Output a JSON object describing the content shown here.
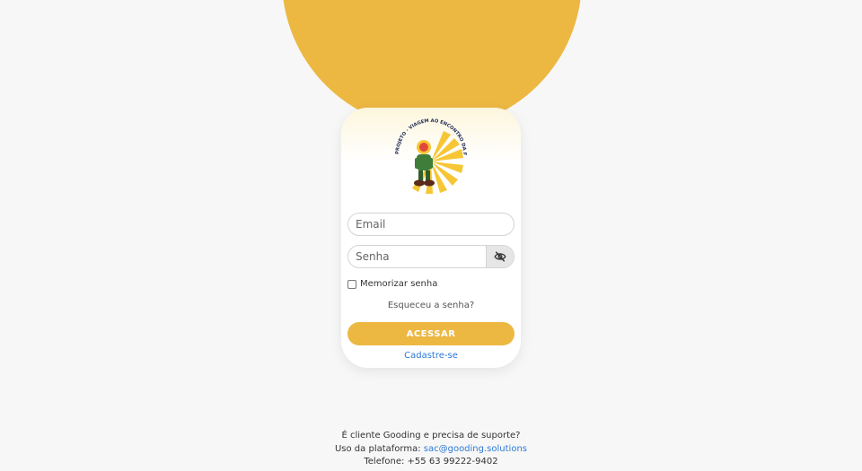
{
  "logo": {
    "arc_text": "PROJETO · VIAGEM AO ENCONTRO DA FELICIDADE",
    "colors": {
      "sun": "#f6c635",
      "body": "#3f7d3a",
      "face": "#e2483a"
    }
  },
  "login": {
    "email_placeholder": "Email",
    "password_placeholder": "Senha",
    "toggle_icon": "eye-off-icon",
    "remember_label": "Memorizar senha",
    "remember_checked": false,
    "forgot_label": "Esqueceu a senha?",
    "submit_label": "ACESSAR",
    "signup_label": "Cadastre-se"
  },
  "footer": {
    "line1": "É cliente Gooding e precisa de suporte?",
    "line2_prefix": "Uso da plataforma: ",
    "support_email": "sac@gooding.solutions",
    "line3": "Telefone: +55 63 99222-9402"
  },
  "colors": {
    "accent": "#ecb842",
    "link": "#2d7ad6",
    "background": "#f7f7f7"
  }
}
